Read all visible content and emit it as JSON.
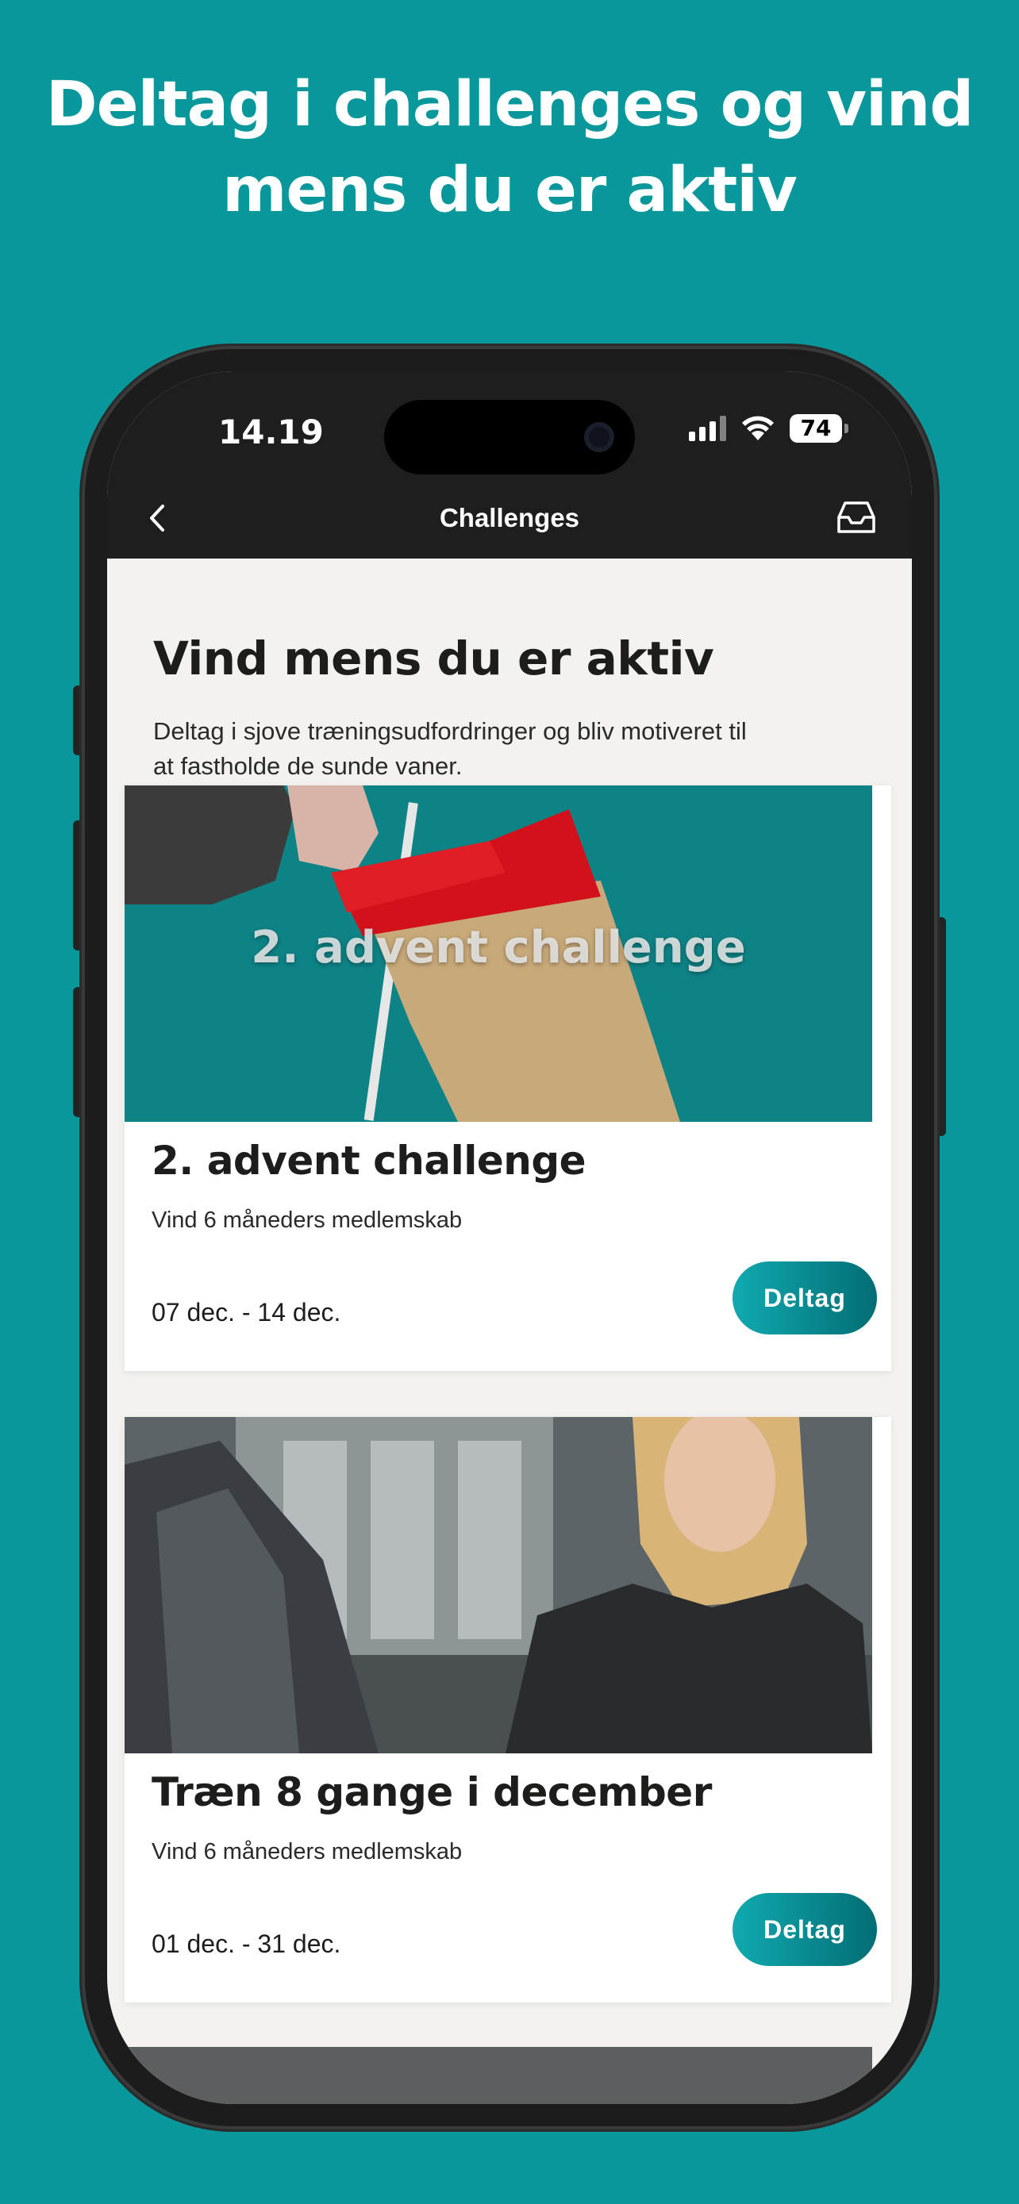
{
  "headline": {
    "line1": "Deltag i challenges og vind",
    "line2": "mens du er aktiv"
  },
  "status_bar": {
    "time": "14.19",
    "battery": "74"
  },
  "nav": {
    "title": "Challenges",
    "back_icon": "chevron-left-icon",
    "inbox_icon": "inbox-tray-icon"
  },
  "intro": {
    "title": "Vind mens du er aktiv",
    "description": "Deltag i sjove træningsudfordringer og bliv motiveret til at fastholde de sunde vaner."
  },
  "challenges": [
    {
      "image_text": "2. advent challenge",
      "title": "2. advent challenge",
      "prize": "Vind 6 måneders medlemskab",
      "dates": "07 dec. - 14 dec.",
      "button": "Deltag"
    },
    {
      "title": "Træn 8 gange i december",
      "prize": "Vind 6 måneders medlemskab",
      "dates": "01 dec. - 31 dec.",
      "button": "Deltag"
    }
  ],
  "colors": {
    "background": "#08979a",
    "nav_bar": "#1e1e1e",
    "content_bg": "#f4f2ee",
    "button_gradient_start": "#10aab0",
    "button_gradient_end": "#036d74"
  }
}
